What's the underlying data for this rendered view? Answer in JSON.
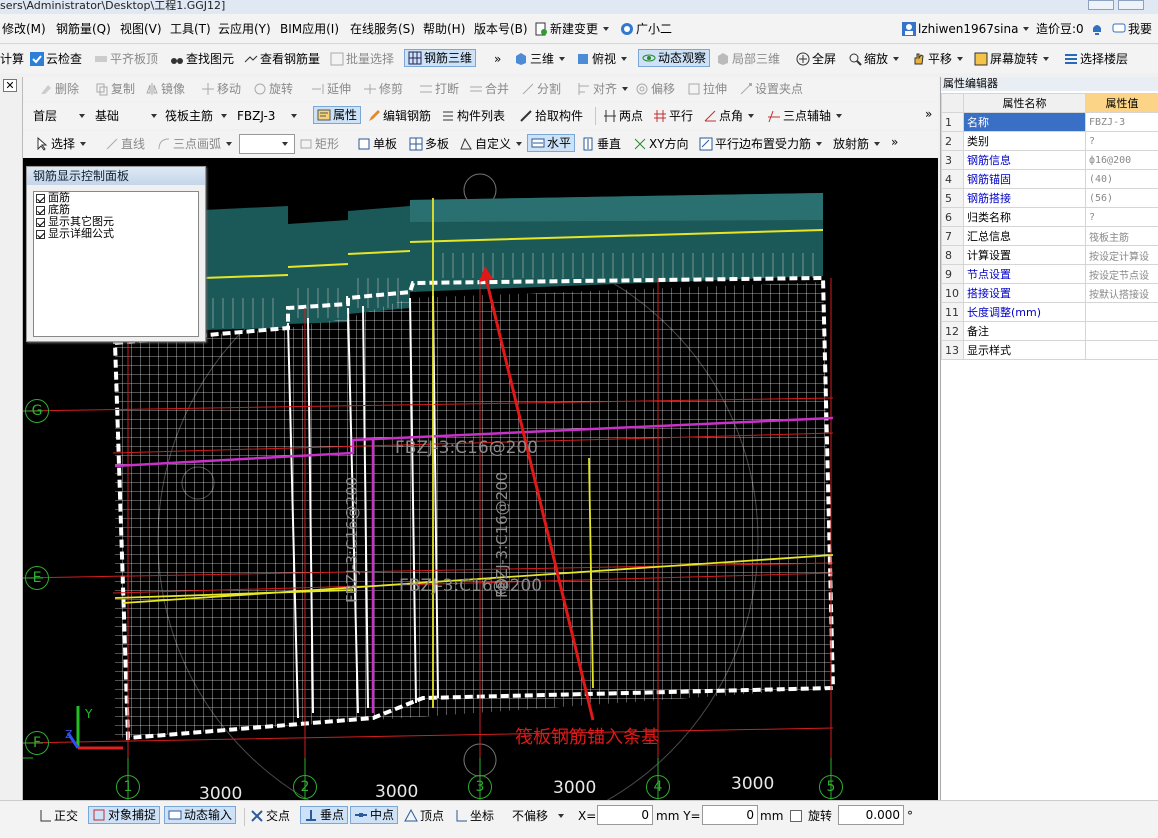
{
  "window": {
    "title": "sers\\Administrator\\Desktop\\工程1.GGJ12]"
  },
  "menu": {
    "items": [
      "修改(M)",
      "钢筋量(Q)",
      "视图(V)",
      "工具(T)",
      "云应用(Y)",
      "BIM应用(I)",
      "在线服务(S)",
      "帮助(H)",
      "版本号(B)"
    ],
    "new_change": "新建变更",
    "assistant": "广小二",
    "user": "lzhiwen1967sina",
    "coins": "造价豆:0",
    "want": "我要"
  },
  "toolbar1": {
    "items": [
      "计算",
      "云检查",
      "平齐板顶",
      "查找图元",
      "查看钢筋量",
      "批量选择",
      "钢筋三维",
      "三维",
      "俯视",
      "动态观察",
      "局部三维",
      "全屏",
      "缩放",
      "平移",
      "屏幕旋转",
      "选择楼层"
    ],
    "more": "»"
  },
  "toolbar2": {
    "items": [
      "删除",
      "复制",
      "镜像",
      "移动",
      "旋转",
      "延伸",
      "修剪",
      "打断",
      "合并",
      "分割",
      "对齐",
      "偏移",
      "拉伸",
      "设置夹点"
    ]
  },
  "toolbar3": {
    "floor": "首层",
    "category": "基础",
    "type": "筏板主筋",
    "element": "FBZJ-3",
    "items": [
      "属性",
      "编辑钢筋",
      "构件列表",
      "拾取构件",
      "两点",
      "平行",
      "点角",
      "三点辅轴"
    ],
    "more": "»"
  },
  "toolbar4": {
    "items": [
      "选择",
      "直线",
      "三点画弧",
      "矩形",
      "单板",
      "多板",
      "自定义",
      "水平",
      "垂直",
      "XY方向",
      "平行边布置受力筋",
      "放射筋"
    ],
    "more": "»"
  },
  "control_panel": {
    "title": "钢筋显示控制面板",
    "options": [
      "面筋",
      "底筋",
      "显示其它图元",
      "显示详细公式"
    ]
  },
  "viewport": {
    "axis_rows": [
      "G",
      "E",
      "F"
    ],
    "axis_cols": [
      "1",
      "2",
      "3",
      "4",
      "5"
    ],
    "spacings": [
      "3000",
      "3000",
      "3000",
      "3000"
    ],
    "labels": [
      "FBZJ-3:C16@200",
      "FBZJ-3:C16@200",
      "FBZJ-3:C16@200",
      "FBZJ-3:C16@200"
    ],
    "annotation": "筏板钢筋锚入条基",
    "colors": {
      "slab": "#1b5858",
      "grid": "#ffffff",
      "red": "#d21e1e",
      "yellow": "#e6e628",
      "magenta": "#c832c8",
      "axis": "#2fae2f"
    }
  },
  "properties": {
    "panel_title": "属性编辑器",
    "col_name": "属性名称",
    "col_value": "属性值",
    "rows": [
      {
        "n": "1",
        "name": "名称",
        "value": "FBZJ-3"
      },
      {
        "n": "2",
        "name": "类别",
        "value": "?"
      },
      {
        "n": "3",
        "name": "钢筋信息",
        "value": "ф16@200"
      },
      {
        "n": "4",
        "name": "钢筋锚固",
        "value": "(40)"
      },
      {
        "n": "5",
        "name": "钢筋搭接",
        "value": "(56)"
      },
      {
        "n": "6",
        "name": "归类名称",
        "value": "?"
      },
      {
        "n": "7",
        "name": "汇总信息",
        "value": "筏板主筋"
      },
      {
        "n": "8",
        "name": "计算设置",
        "value": "按设定计算设"
      },
      {
        "n": "9",
        "name": "节点设置",
        "value": "按设定节点设"
      },
      {
        "n": "10",
        "name": "搭接设置",
        "value": "按默认搭接设"
      },
      {
        "n": "11",
        "name": "长度调整(mm)",
        "value": ""
      },
      {
        "n": "12",
        "name": "备注",
        "value": ""
      },
      {
        "n": "13",
        "name": "显示样式",
        "value": ""
      }
    ]
  },
  "statusbar": {
    "items": [
      "正交",
      "对象捕捉",
      "动态输入",
      "交点",
      "垂点",
      "中点",
      "顶点",
      "坐标"
    ],
    "offset": "不偏移",
    "x_label": "X=",
    "x_value": "0",
    "y_label": "mm Y=",
    "y_value": "0",
    "unit": "mm",
    "rotate_label": "旋转",
    "rotate_value": "0.000",
    "degree": "°"
  }
}
